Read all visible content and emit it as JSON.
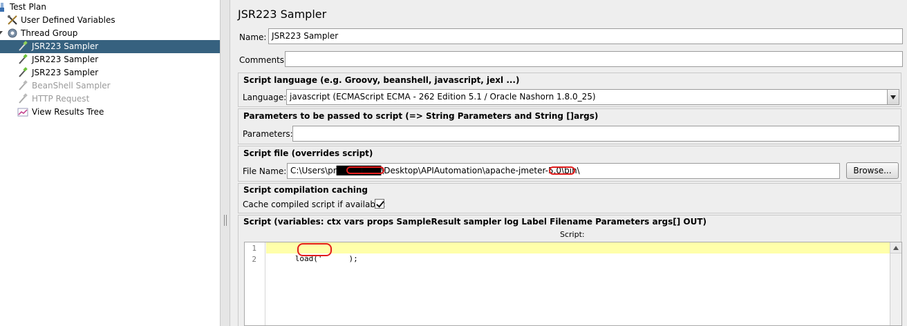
{
  "tree": {
    "items": [
      {
        "label": "Test Plan",
        "icon": "test-plan-icon",
        "selected": false,
        "disabled": false
      },
      {
        "label": "User Defined Variables",
        "icon": "tools-icon",
        "selected": false,
        "disabled": false
      },
      {
        "label": "Thread Group",
        "icon": "gear-icon",
        "selected": false,
        "disabled": false
      },
      {
        "label": "JSR223 Sampler",
        "icon": "pipette-icon",
        "selected": true,
        "disabled": false
      },
      {
        "label": "JSR223 Sampler",
        "icon": "pipette-icon",
        "selected": false,
        "disabled": false
      },
      {
        "label": "JSR223 Sampler",
        "icon": "pipette-icon",
        "selected": false,
        "disabled": false
      },
      {
        "label": "BeanShell Sampler",
        "icon": "pipette-icon",
        "selected": false,
        "disabled": true
      },
      {
        "label": "HTTP Request",
        "icon": "pipette-icon",
        "selected": false,
        "disabled": true
      },
      {
        "label": "View Results Tree",
        "icon": "chart-icon",
        "selected": false,
        "disabled": false
      }
    ]
  },
  "panel": {
    "title": "JSR223 Sampler",
    "name_label": "Name:",
    "name_value": "JSR223 Sampler",
    "comments_label": "Comments:",
    "comments_value": ""
  },
  "script_language": {
    "section_title": "Script language (e.g. Groovy, beanshell, javascript, jexl ...)",
    "label": "Language:",
    "selected_value": "javascript     (ECMAScript ECMA - 262 Edition 5.1 / Oracle Nashorn 1.8.0_25)"
  },
  "parameters": {
    "section_title": "Parameters to be passed to script (=> String Parameters and String []args)",
    "label": "Parameters:",
    "value": ""
  },
  "script_file": {
    "section_title": "Script file (overrides script)",
    "label": "File Name:",
    "value": "C:\\Users\\pr███████\\Desktop\\APIAutomation\\apache-jmeter-5.0\\bin\\",
    "browse_label": "Browse..."
  },
  "caching": {
    "section_title": "Script compilation caching",
    "label": "Cache compiled script if available:",
    "checked": true
  },
  "script": {
    "section_title": "Script (variables: ctx vars props SampleResult sampler log Label Filename Parameters args[] OUT)",
    "editor_label": "Script:",
    "line_numbers": [
      "1",
      "2"
    ],
    "lines": [
      "load('",
      ""
    ],
    "line1_suffix": ");"
  },
  "colors": {
    "selection": "#36617f",
    "current_line": "#ffffaa",
    "redaction": "#e21b1b"
  }
}
